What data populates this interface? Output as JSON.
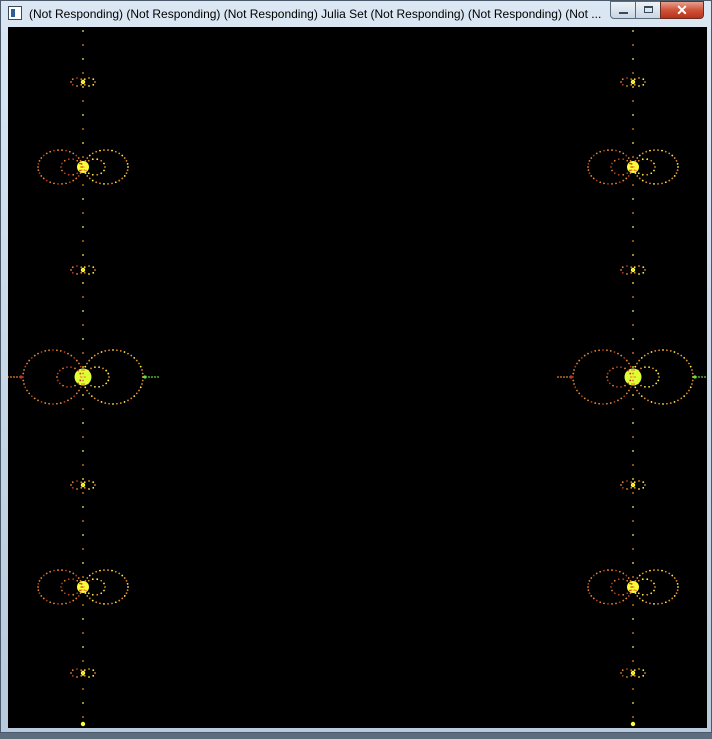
{
  "window": {
    "title": "(Not Responding) (Not Responding) (Not Responding) Julia Set (Not Responding) (Not Responding) (Not ...",
    "close_glyph": "✕"
  },
  "icons": {
    "app": "window-app-icon",
    "minimize": "minimize-icon",
    "maximize": "maximize-icon",
    "close": "close-icon"
  },
  "colors": {
    "canvas_background": "#000000",
    "bright_core": "#ffff33",
    "core_large": "#ddff33",
    "dot_orange": "#e58a2e",
    "dot_red": "#b83a1e",
    "dot_green": "#66dd33",
    "dot_yellow": "#ffee44"
  }
}
